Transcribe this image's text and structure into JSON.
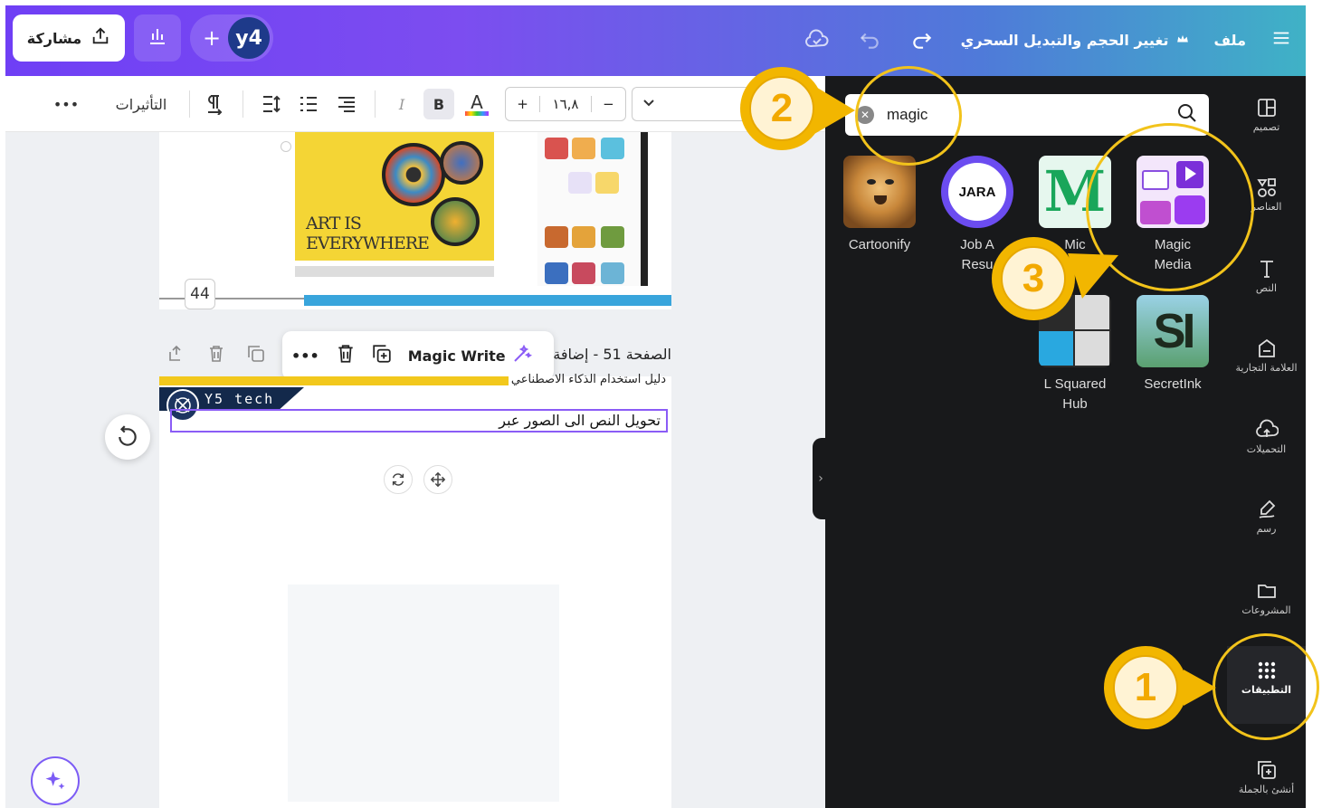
{
  "topbar": {
    "share_label": "مشاركة",
    "avatar_initials": "y4",
    "plus": "+",
    "title": "تغيير الحجم والتبديل السحري",
    "file_menu": "ملف"
  },
  "formatbar": {
    "more": "•••",
    "effects_label": "التأثيرات",
    "bold": "B",
    "italic": "I",
    "text_color": "A",
    "size_plus": "+",
    "size_value": "١٦,٨",
    "size_minus": "−"
  },
  "canvas": {
    "page1_art_text_line1": "ART IS",
    "page1_art_text_line2": "EVERYWHERE",
    "page_number_badge": "44",
    "page2_title": "الصفحة 51 - إضافة",
    "page2_subtitle": "دليل استخدام الذكاء الاصطناعي",
    "banner_text": "Y5 tech",
    "text_box_value": "تحويل النص الى الصور عبر",
    "ctx_more": "•••",
    "magic_write": "Magic Write"
  },
  "panel": {
    "search_value": "magic",
    "apps": [
      {
        "name": "Cartoonify",
        "label": "Cartoonify"
      },
      {
        "name": "Job Resume",
        "label": "Job A\nResu"
      },
      {
        "name": "M app",
        "label": "Mic"
      },
      {
        "name": "Magic Media",
        "label": "Magic\nMedia"
      },
      {
        "name": "L Squared Hub",
        "label": "L Squared\nHub"
      },
      {
        "name": "SecretInk",
        "label": "SecretInk"
      }
    ],
    "jara_text": "JARA"
  },
  "rail": {
    "items": [
      {
        "icon": "layout-icon",
        "label": "تصميم"
      },
      {
        "icon": "elements-icon",
        "label": "العناصر"
      },
      {
        "icon": "text-icon",
        "label": "النص"
      },
      {
        "icon": "brand-icon",
        "label": "العلامة التجارية"
      },
      {
        "icon": "upload-icon",
        "label": "التحميلات"
      },
      {
        "icon": "draw-icon",
        "label": "رسم"
      },
      {
        "icon": "folder-icon",
        "label": "المشروعات"
      },
      {
        "icon": "apps-icon",
        "label": "التطبيقات"
      },
      {
        "icon": "bulk-icon",
        "label": "أنشئ بالجملة"
      }
    ]
  },
  "annotations": {
    "step1": "1",
    "step2": "2",
    "step3": "3"
  },
  "colors": {
    "accent_purple": "#7c4df0",
    "annotation_yellow": "#f2b600",
    "panel_dark": "#18191b"
  }
}
